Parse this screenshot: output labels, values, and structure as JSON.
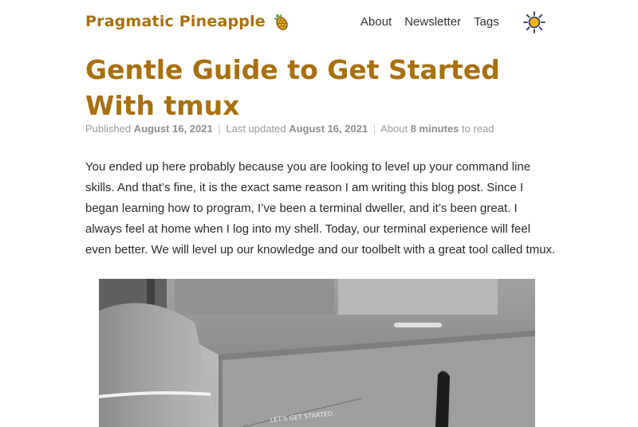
{
  "site": {
    "name": "Pragmatic Pineapple",
    "logo_icon": "pineapple-icon"
  },
  "nav": {
    "items": [
      {
        "label": "About"
      },
      {
        "label": "Newsletter"
      },
      {
        "label": "Tags"
      }
    ],
    "theme_icon": "sun-icon"
  },
  "post": {
    "title": "Gentle Guide to Get Started With tmux",
    "meta": {
      "published_label": "Published",
      "published_date": "August 16, 2021",
      "separator": "|",
      "updated_label": "Last updated",
      "updated_date": "August 16, 2021",
      "about_label": "About",
      "read_time": "8 minutes",
      "read_suffix": "to read"
    },
    "intro": "You ended up here probably because you are looking to level up your command line skills. And that’s fine, it is the exact same reason I am writing this blog post. Since I began learning how to program, I’ve been a terminal dweller, and it’s been great. I always feel at home when I log into my shell. Today, our terminal experience will feel even better. We will level up our knowledge and our toolbelt with a great tool called tmux.",
    "hero_caption_text": "LET'S GET STARTED."
  },
  "colors": {
    "accent": "#a8700e",
    "text": "#2a2a2a",
    "meta": "#999999"
  }
}
